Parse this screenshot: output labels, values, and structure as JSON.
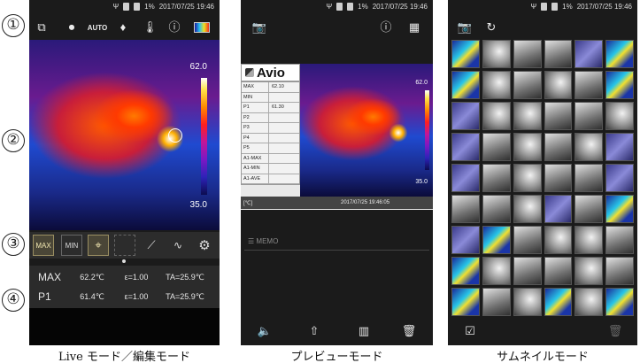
{
  "markers": [
    "①",
    "②",
    "③",
    "④"
  ],
  "status": {
    "usb_icon": "Ψ",
    "battery": "1%",
    "datetime": "2017/07/25 19:46"
  },
  "live": {
    "caption": "Live モード／編集モード",
    "top_auto": "AUTO",
    "scale_max": "62.0",
    "scale_min": "35.0",
    "tool_max": "MAX",
    "tool_min": "MIN",
    "readout": [
      {
        "label": "MAX",
        "temp": "62.2℃",
        "emis": "ε=1.00",
        "ta": "TA=25.9℃"
      },
      {
        "label": "P1",
        "temp": "61.4℃",
        "emis": "ε=1.00",
        "ta": "TA=25.9℃"
      }
    ]
  },
  "preview": {
    "caption": "プレビューモード",
    "brand": "Avio",
    "scale_max": "62.0",
    "scale_min": "35.0",
    "table": [
      {
        "k": "MAX",
        "v": "62.10"
      },
      {
        "k": "MIN",
        "v": ""
      },
      {
        "k": "P1",
        "v": "61.30"
      },
      {
        "k": "P2",
        "v": ""
      },
      {
        "k": "P3",
        "v": ""
      },
      {
        "k": "P4",
        "v": ""
      },
      {
        "k": "P5",
        "v": ""
      },
      {
        "k": "A1-MAX",
        "v": ""
      },
      {
        "k": "A1-MIN",
        "v": ""
      },
      {
        "k": "A1-AVE",
        "v": ""
      }
    ],
    "unit": "[℃]",
    "timestamp": "2017/07/25 19:46:05",
    "memo": "MEMO"
  },
  "thumbs": {
    "caption": "サムネイルモード",
    "pattern": [
      "a",
      "b",
      "d",
      "d",
      "c",
      "a",
      "a",
      "b",
      "d",
      "b",
      "d",
      "a",
      "c",
      "b",
      "b",
      "d",
      "d",
      "b",
      "c",
      "d",
      "b",
      "d",
      "b",
      "c",
      "c",
      "d",
      "b",
      "d",
      "d",
      "c",
      "d",
      "d",
      "b",
      "c",
      "d",
      "a",
      "c",
      "a",
      "d",
      "b",
      "b",
      "d",
      "a",
      "b",
      "d",
      "d",
      "b",
      "d",
      "a",
      "d",
      "b",
      "a",
      "b",
      "a"
    ]
  }
}
